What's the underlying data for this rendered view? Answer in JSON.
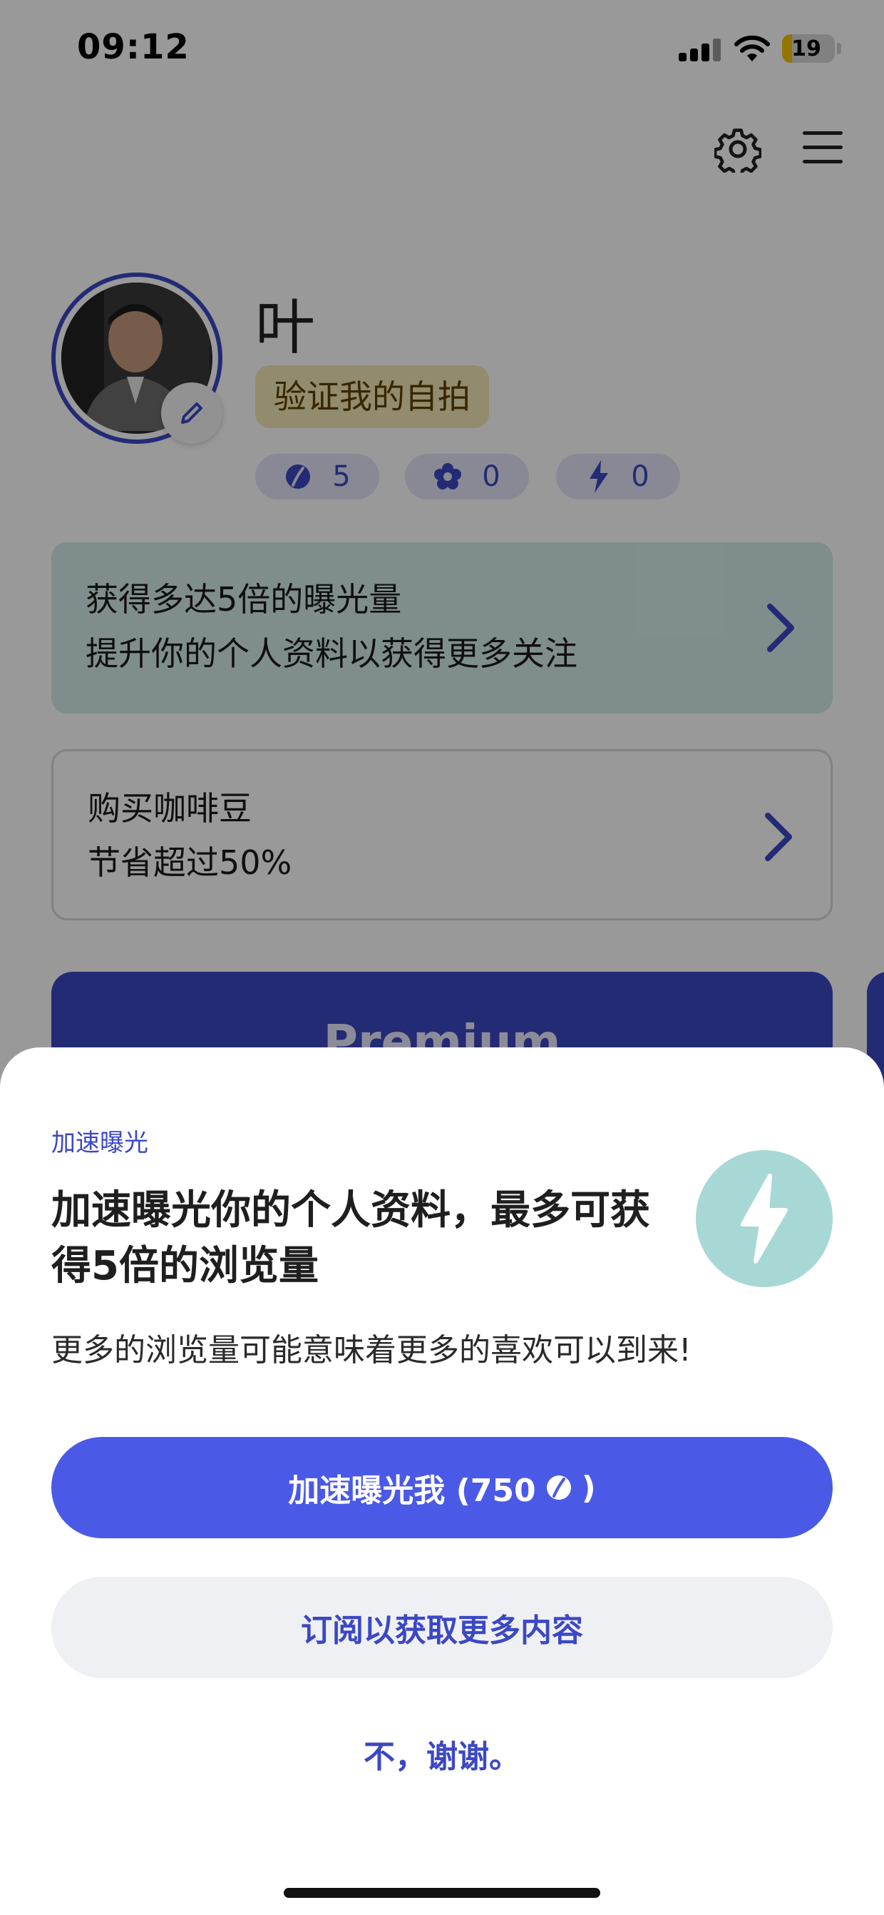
{
  "status_bar": {
    "time": "09:12",
    "battery": "19"
  },
  "profile": {
    "name": "叶",
    "verify_label": "验证我的自拍",
    "stats": [
      {
        "icon": "coffee-bean-icon",
        "value": "5"
      },
      {
        "icon": "flower-icon",
        "value": "0"
      },
      {
        "icon": "lightning-icon",
        "value": "0"
      }
    ]
  },
  "cards": {
    "boost": {
      "title": "获得多达5倍的曝光量",
      "subtitle": "提升你的个人资料以获得更多关注"
    },
    "beans": {
      "title": "购买咖啡豆",
      "subtitle": "节省超过50%"
    }
  },
  "premium_label": "Premium",
  "sheet": {
    "eyebrow": "加速曝光",
    "title": "加速曝光你的个人资料，最多可获得5倍的浏览量",
    "subtitle": "更多的浏览量可能意味着更多的喜欢可以到来!",
    "primary_label": "加速曝光我 (750",
    "primary_suffix": ")",
    "secondary_label": "订阅以获取更多内容",
    "dismiss_label": "不，谢谢。"
  },
  "colors": {
    "accent": "#4a59e6",
    "accent_dark": "#3b48c4",
    "boost_card_bg": "#d6ecec",
    "bolt_circle": "#a7d8d6",
    "verify_badge_bg": "#f6e8b6"
  }
}
